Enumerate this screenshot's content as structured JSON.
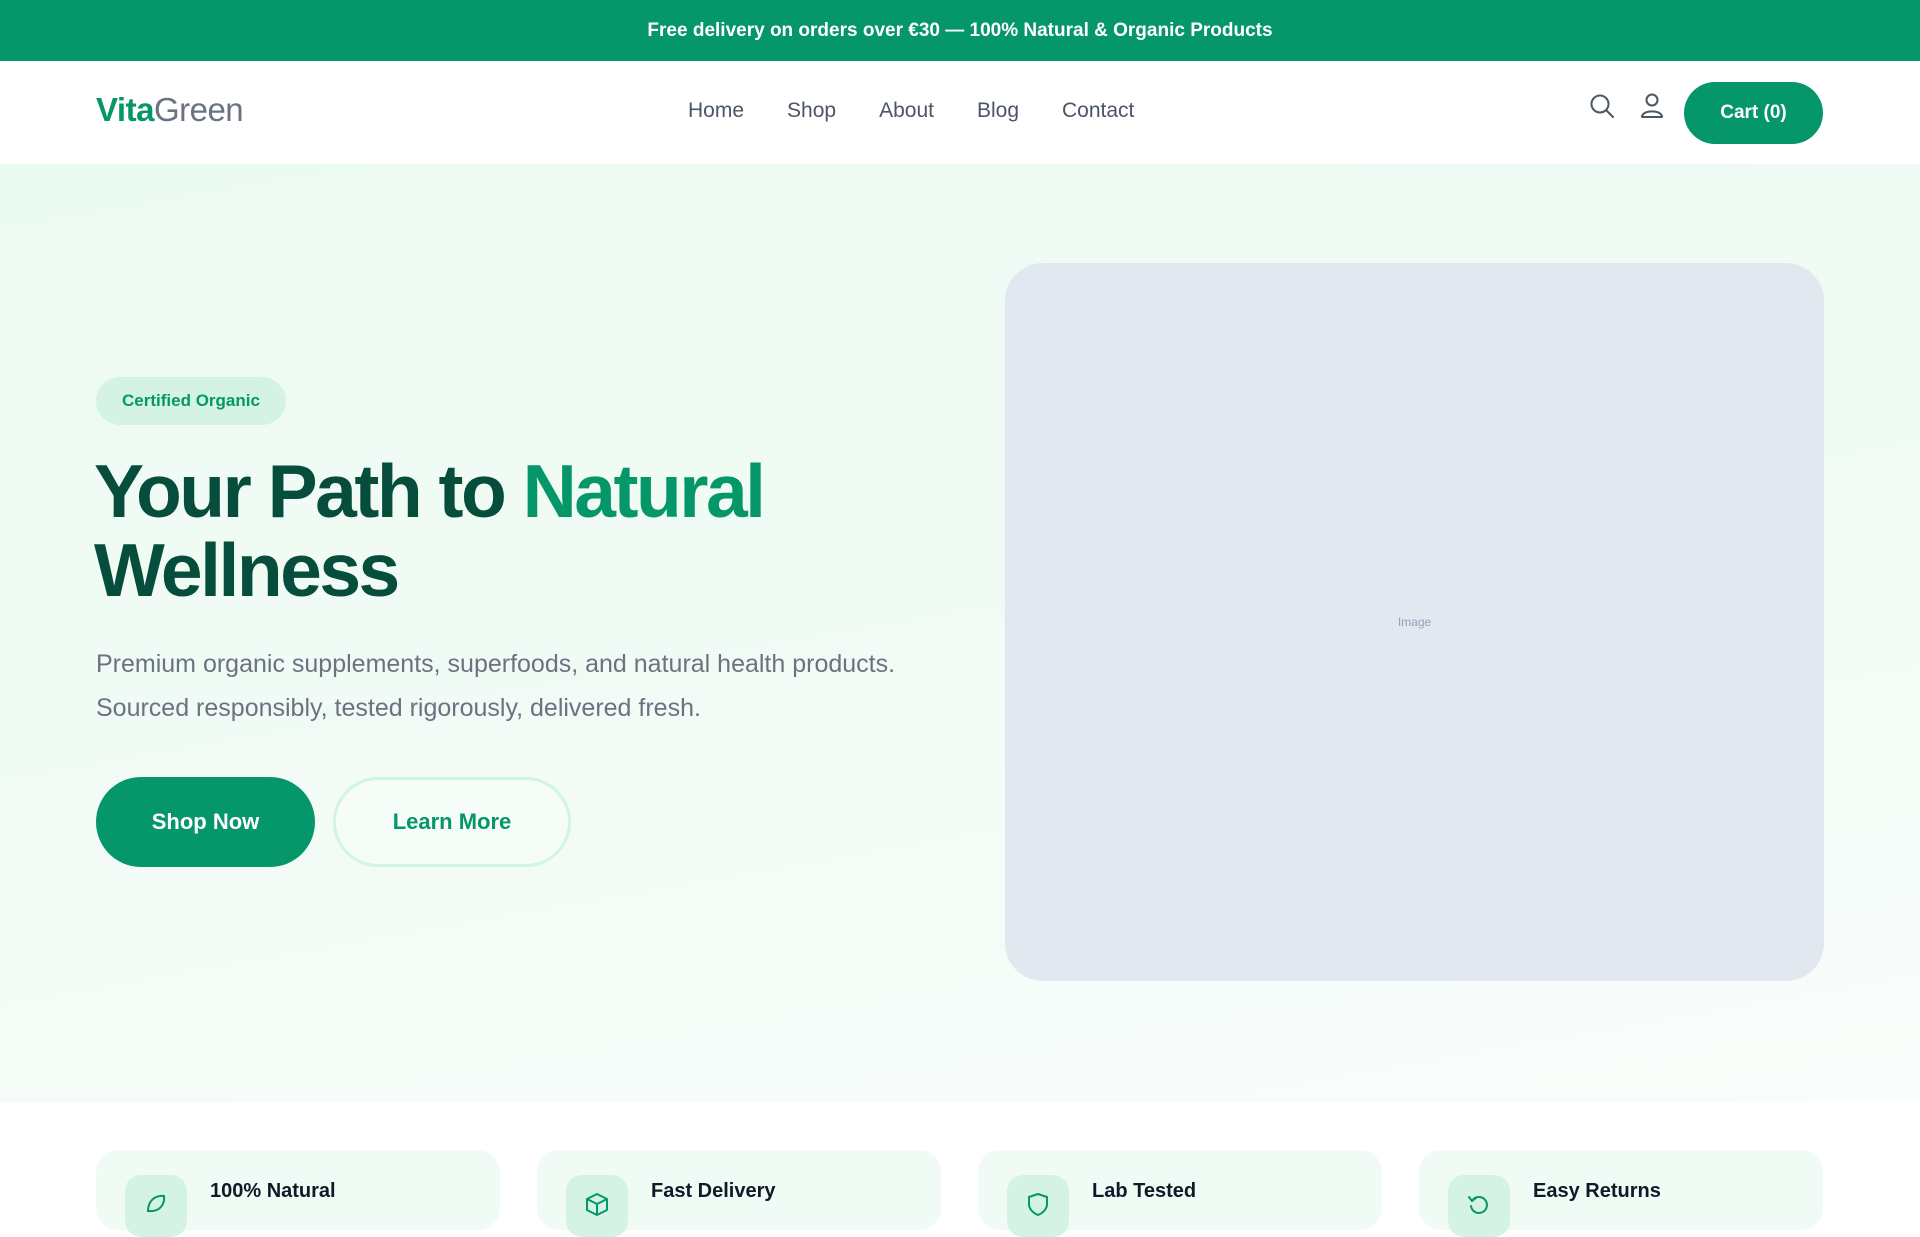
{
  "announcement": {
    "text": "Free delivery on orders over €30 — 100% Natural & Organic Products"
  },
  "brand": {
    "part1": "Vita",
    "part2": "Green"
  },
  "nav": {
    "items": [
      {
        "label": "Home"
      },
      {
        "label": "Shop"
      },
      {
        "label": "About"
      },
      {
        "label": "Blog"
      },
      {
        "label": "Contact"
      }
    ]
  },
  "header": {
    "icons": [
      "search-icon",
      "user-icon"
    ],
    "cart_label": "Cart (0)"
  },
  "hero": {
    "badge": "Certified Organic",
    "headline_part1": "Your Path to",
    "headline_accent": "Natural",
    "headline_part2": "Wellness",
    "subtext": "Premium organic supplements, superfoods, and natural health products. Sourced responsibly, tested rigorously, delivered fresh.",
    "primary_button": "Shop Now",
    "secondary_button": "Learn More",
    "image_placeholder": "Image"
  },
  "features": [
    {
      "title": "100% Natural",
      "icon": "leaf-icon"
    },
    {
      "title": "Fast Delivery",
      "icon": "box-icon"
    },
    {
      "title": "Lab Tested",
      "icon": "shield-icon"
    },
    {
      "title": "Easy Returns",
      "icon": "return-icon"
    }
  ],
  "colors": {
    "brand": "#059669",
    "brand_dark": "#064e3b",
    "text_muted": "#6b7280",
    "badge_bg": "#d5f3e4",
    "image_bg": "#e2e8f0"
  }
}
